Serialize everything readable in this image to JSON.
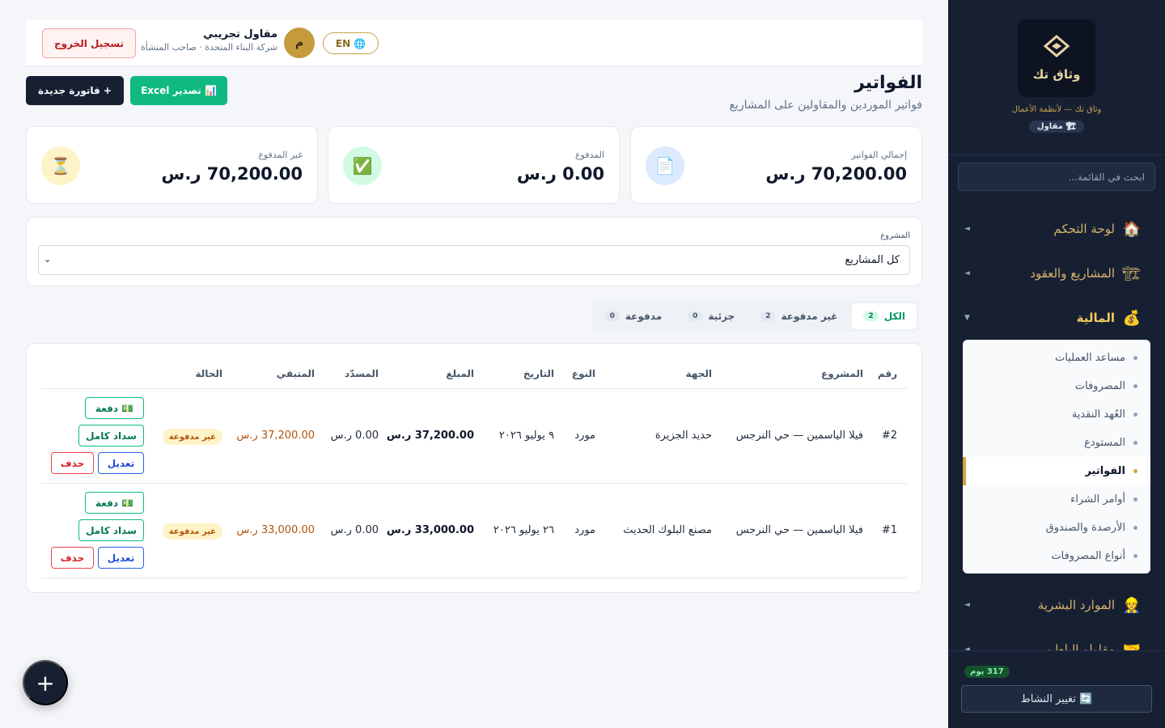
{
  "sidebar": {
    "logo_text": "وثاق تك",
    "tagline": "وثاق تك — لأنظمة الأعمال",
    "role_badge": "🏗 مقاول",
    "search_placeholder": "ابحث في القائمة...",
    "nav": [
      {
        "icon": "🏠",
        "label": "لوحة التحكم",
        "arrow": "◄"
      },
      {
        "icon": "🏗",
        "label": "المشاريع والعقود",
        "arrow": "◄"
      },
      {
        "icon": "💰",
        "label": "المالية",
        "arrow": "▼"
      },
      {
        "icon": "👷",
        "label": "الموارد البشرية",
        "arrow": "◄"
      },
      {
        "icon": "🤝",
        "label": "مقاولو الباطن",
        "arrow": "◄"
      }
    ],
    "finance_sub": [
      "مساعد العمليات",
      "المصروفات",
      "العُهد النقدية",
      "المستودع",
      "الفواتير",
      "أوامر الشراء",
      "الأرصدة والصندوق",
      "أنواع المصروفات"
    ],
    "days_badge": "317 يوم",
    "switch_label": "🔄 تغيير النشاط"
  },
  "topbar": {
    "logout": "تسجيل الخروج",
    "user_name": "مقاول تجريبي",
    "user_sub": "شركة البناء المتحدة · صاحب المنشأة",
    "avatar_letter": "م",
    "lang": "EN"
  },
  "page": {
    "title": "الفواتير",
    "subtitle": "فواتير الموردين والمقاولين على المشاريع",
    "new_invoice": "+ فاتورة جديدة",
    "export_excel": "📊 تصدير Excel"
  },
  "stats": [
    {
      "label": "إجمالي الفواتير",
      "value": "70,200.00 ر.س",
      "icon": "📄"
    },
    {
      "label": "المدفوع",
      "value": "0.00 ر.س",
      "icon": "✅"
    },
    {
      "label": "غير المدفوع",
      "value": "70,200.00 ر.س",
      "icon": "⏳"
    }
  ],
  "filter": {
    "label": "المشروع",
    "value": "كل المشاريع"
  },
  "tabs": [
    {
      "label": "الكل",
      "count": "2"
    },
    {
      "label": "غير مدفوعة",
      "count": "2"
    },
    {
      "label": "جزئية",
      "count": "0"
    },
    {
      "label": "مدفوعة",
      "count": "0"
    }
  ],
  "table": {
    "headers": [
      "رقم",
      "المشروع",
      "الجهة",
      "النوع",
      "التاريخ",
      "المبلغ",
      "المسدّد",
      "المتبقي",
      "الحالة"
    ],
    "rows": [
      {
        "num": "#2",
        "project": "فيلا الياسمين — حي النرجس",
        "party": "حديد الجزيرة",
        "type": "مورد",
        "date": "٩ يوليو ٢٠٢٦",
        "amount": "37,200.00 ر.س",
        "paid": "0.00 ر.س",
        "remaining": "37,200.00 ر.س",
        "status": "غير مدفوعة"
      },
      {
        "num": "#1",
        "project": "فيلا الياسمين — حي النرجس",
        "party": "مصنع البلوك الحديث",
        "type": "مورد",
        "date": "٢٦ يوليو ٢٠٢٦",
        "amount": "33,000.00 ر.س",
        "paid": "0.00 ر.س",
        "remaining": "33,000.00 ر.س",
        "status": "غير مدفوعة"
      }
    ],
    "actions": {
      "payment": "💵 دفعة",
      "full_pay": "سداد كامل",
      "edit": "تعديل",
      "delete": "حذف"
    }
  },
  "fab": "+"
}
